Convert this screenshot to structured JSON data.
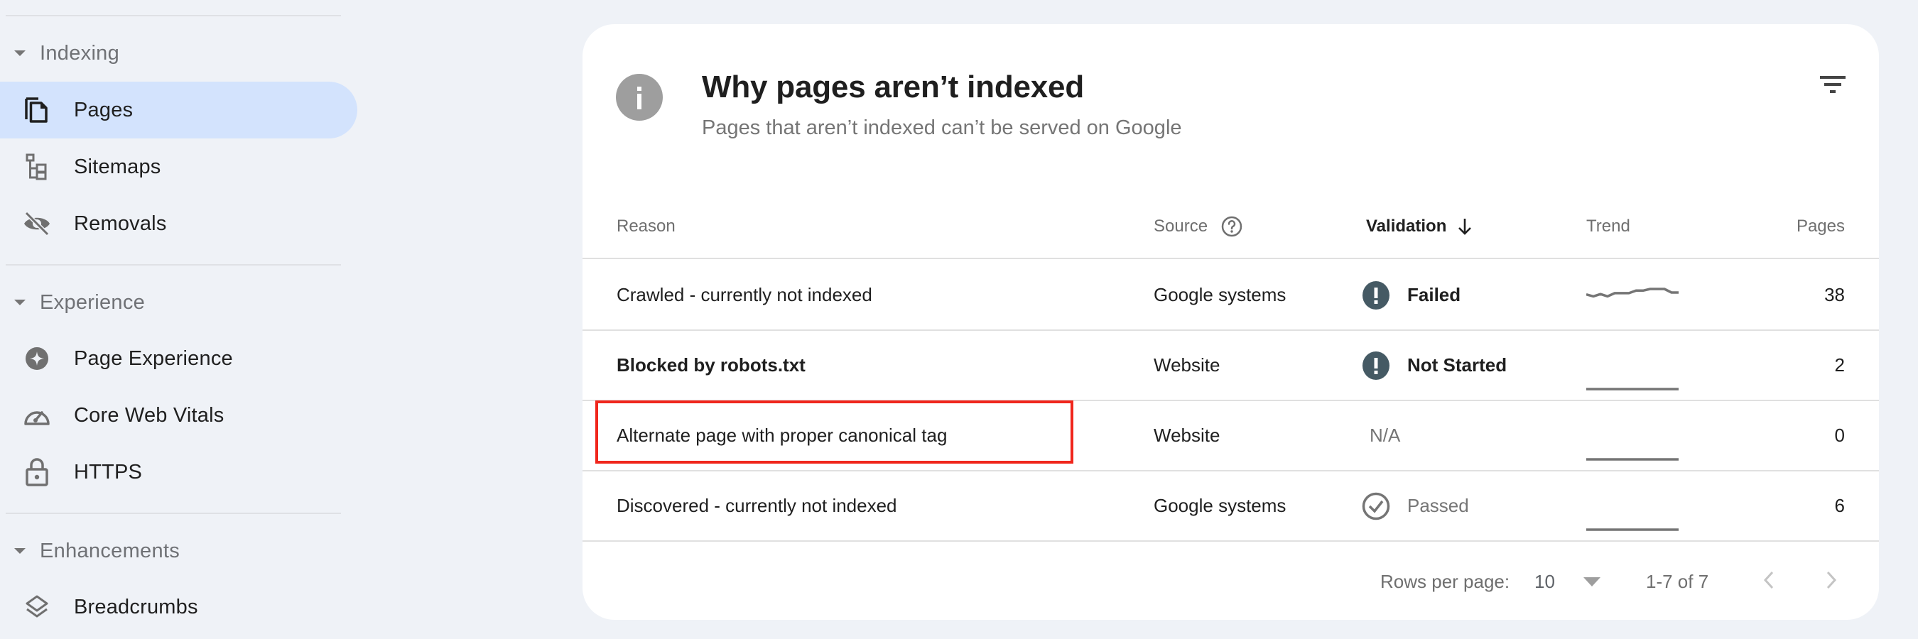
{
  "sidebar": {
    "sections": [
      {
        "title": "Indexing",
        "items": [
          {
            "label": "Pages",
            "icon": "pages-icon",
            "active": true
          },
          {
            "label": "Sitemaps",
            "icon": "sitemap-icon"
          },
          {
            "label": "Removals",
            "icon": "visibility-off-icon"
          }
        ]
      },
      {
        "title": "Experience",
        "items": [
          {
            "label": "Page Experience",
            "icon": "page-experience-icon"
          },
          {
            "label": "Core Web Vitals",
            "icon": "speedometer-icon"
          },
          {
            "label": "HTTPS",
            "icon": "lock-icon"
          }
        ]
      },
      {
        "title": "Enhancements",
        "items": [
          {
            "label": "Breadcrumbs",
            "icon": "layers-icon"
          }
        ]
      }
    ]
  },
  "card": {
    "icon": "info-icon",
    "title": "Why pages aren’t indexed",
    "subtitle": "Pages that aren’t indexed can’t be served on Google",
    "filter_icon": "filter-icon"
  },
  "table": {
    "columns": {
      "reason": "Reason",
      "source": "Source",
      "validation": "Validation",
      "trend": "Trend",
      "pages": "Pages"
    },
    "sorted_by": "validation",
    "sort_direction": "descending",
    "rows": [
      {
        "reason": "Crawled - currently not indexed",
        "source": "Google systems",
        "validation": "Failed",
        "validation_status": "failed",
        "trend": [
          0.35,
          0.2,
          0.38,
          0.2,
          0.45,
          0.45,
          0.45,
          0.65,
          0.65,
          0.78,
          0.78,
          0.78,
          0.5,
          0.5
        ],
        "pages": "38"
      },
      {
        "reason": "Blocked by robots.txt",
        "source": "Website",
        "validation": "Not Started",
        "validation_status": "not_started",
        "trend": [
          0,
          0,
          0,
          0,
          0,
          0,
          0,
          0,
          0,
          0,
          0,
          0,
          0,
          0
        ],
        "pages": "2",
        "bold": true
      },
      {
        "reason": "Alternate page with proper canonical tag",
        "source": "Website",
        "validation": "N/A",
        "validation_status": "na",
        "trend": [
          0,
          0,
          0,
          0,
          0,
          0,
          0,
          0,
          0,
          0,
          0,
          0,
          0,
          0
        ],
        "pages": "0",
        "highlighted": true
      },
      {
        "reason": "Discovered - currently not indexed",
        "source": "Google systems",
        "validation": "Passed",
        "validation_status": "passed",
        "trend": [
          0,
          0,
          0,
          0,
          0,
          0,
          0,
          0,
          0,
          0,
          0,
          0,
          0,
          0
        ],
        "pages": "6"
      }
    ]
  },
  "footer": {
    "rows_per_page_label": "Rows per page:",
    "rows_per_page_value": "10",
    "range": "1-7 of 7"
  },
  "colors": {
    "background": "#eff2f7",
    "active_nav": "#d3e3fd",
    "status_icon": "#455a64",
    "highlight_border": "#f0261c",
    "trend_line": "#757575"
  }
}
